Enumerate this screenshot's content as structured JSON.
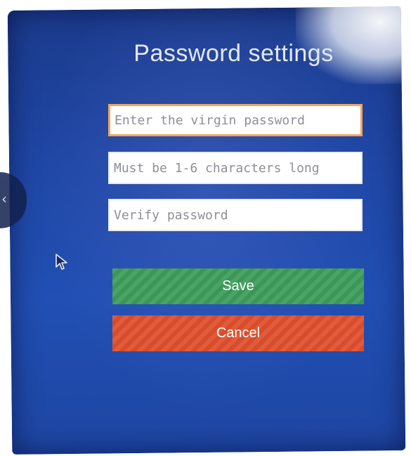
{
  "dialog": {
    "title": "Password settings"
  },
  "fields": {
    "old_password": {
      "placeholder": "Enter the virgin password",
      "value": ""
    },
    "new_password": {
      "placeholder": "Must be 1-6 characters long",
      "value": ""
    },
    "verify_password": {
      "placeholder": "Verify password",
      "value": ""
    }
  },
  "buttons": {
    "save_label": "Save",
    "cancel_label": "Cancel"
  },
  "colors": {
    "background": "#1f47a6",
    "save": "#3e9e5c",
    "cancel": "#e0512e",
    "focus_border": "#f4a55a"
  },
  "icons": {
    "pointer": "mouse-pointer-icon",
    "back": "chevron-left-icon"
  }
}
